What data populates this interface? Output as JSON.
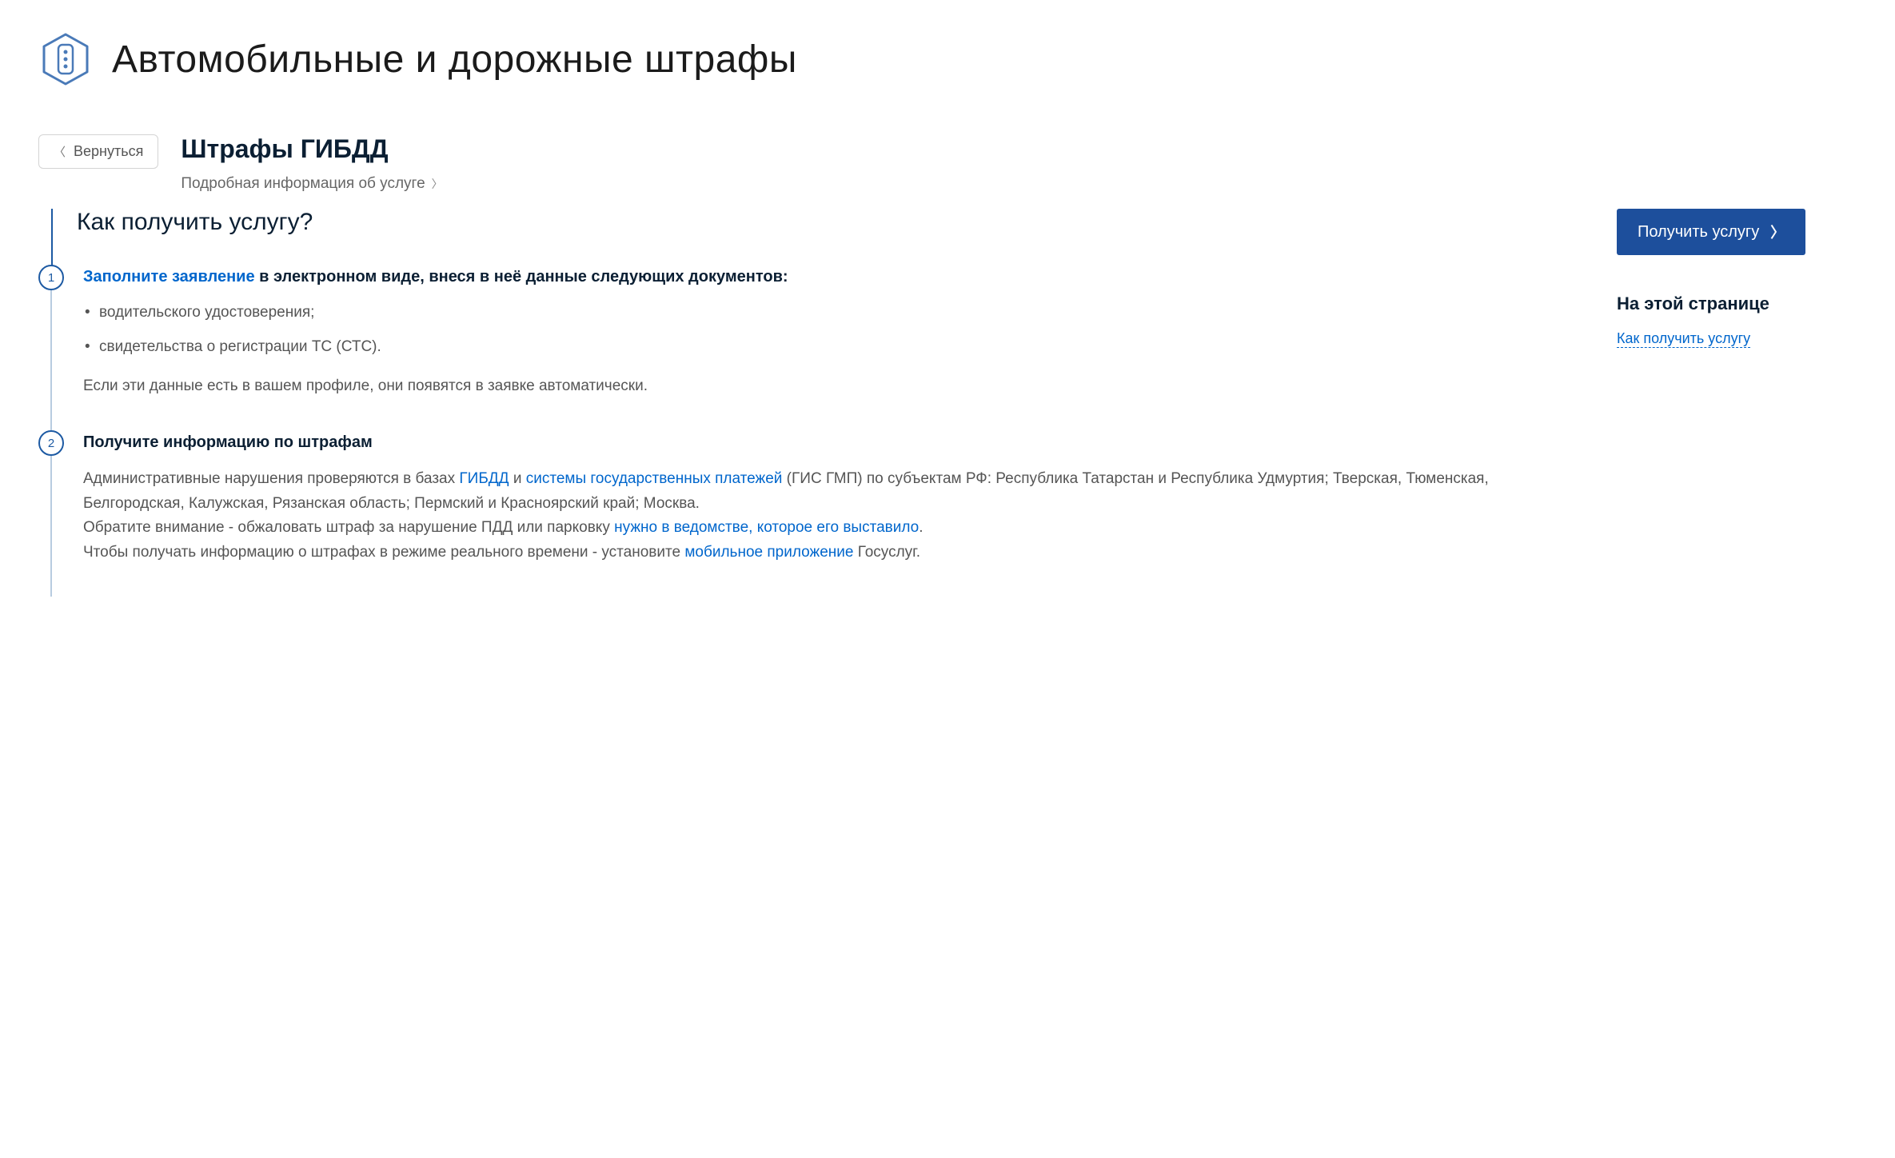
{
  "header": {
    "title": "Автомобильные и дорожные штрафы"
  },
  "back_button": "Вернуться",
  "service": {
    "title": "Штрафы ГИБДД",
    "detail_link": "Подробная информация об услуге"
  },
  "primary_button": "Получить услугу",
  "sidebar": {
    "title": "На этой странице",
    "toc_link": "Как получить услугу"
  },
  "section_heading": "Как получить услугу?",
  "steps": [
    {
      "num": "1",
      "title_link": "Заполните заявление",
      "title_rest": " в электронном виде, внеся в неё данные следующих документов:",
      "bullets": [
        "водительского удостоверения;",
        "свидетельства о регистрации ТС (СТС)."
      ],
      "note": "Если эти данные есть в вашем профиле, они появятся в заявке автоматически."
    },
    {
      "num": "2",
      "title": "Получите информацию по штрафам",
      "para": {
        "p1a": "Административные нарушения проверяются в базах ",
        "link1": "ГИБДД",
        "p1b": " и ",
        "link2": "системы государственных платежей",
        "p1c": " (ГИС ГМП) по субъектам РФ: Республика Татарстан и Республика Удмуртия; Тверская, Тюменская, Белгородская, Калужская, Рязанская область; Пермский и Красноярский край; Москва.",
        "p2a": "Обратите внимание - обжаловать штраф за нарушение ПДД или парковку ",
        "link3": "нужно в ведомстве, которое его выставило",
        "p2b": ".",
        "p3a": "Чтобы получать информацию о штрафах в режиме реального времени - установите ",
        "link4": "мобильное приложение",
        "p3b": " Госуслуг."
      }
    }
  ]
}
